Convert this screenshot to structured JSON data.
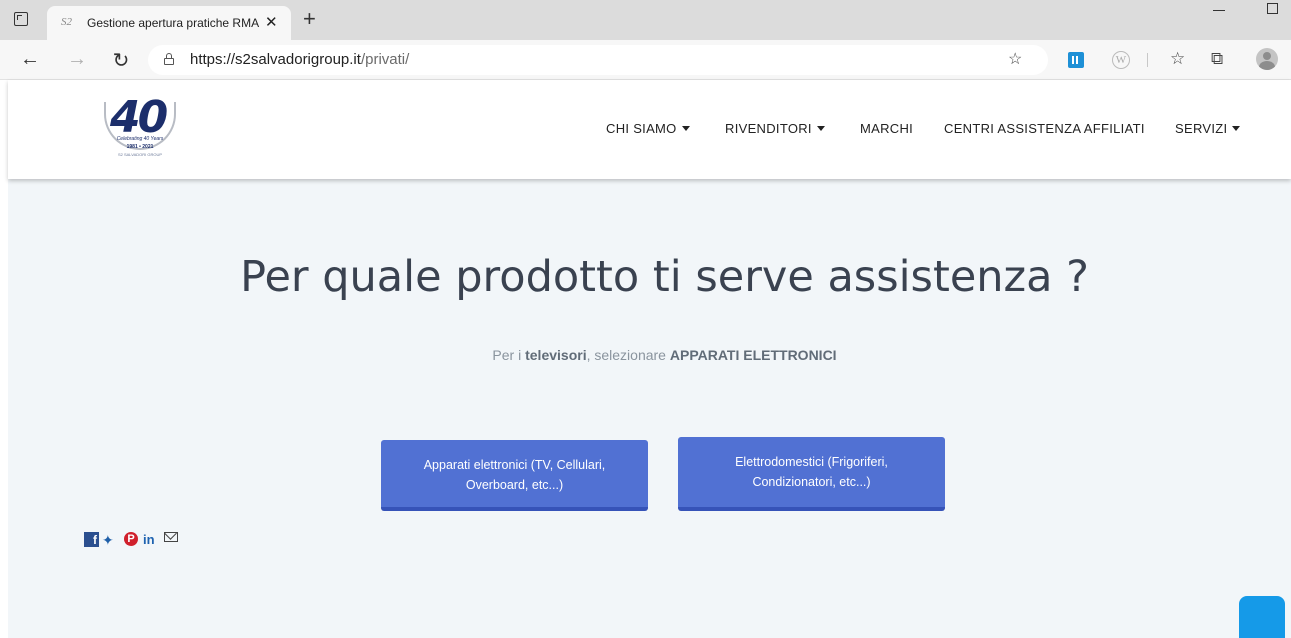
{
  "browser": {
    "tab_title": "Gestione apertura pratiche RMA",
    "tab_favicon": "S2",
    "tab_close": "✕",
    "new_tab": "+",
    "url_host": "https://s2salvadorigroup.it",
    "url_path": "/privati/",
    "icons": {
      "back": "←",
      "forward": "→",
      "refresh": "↻",
      "favorites_add": "☆",
      "extension_w": "W",
      "favorites": "☆",
      "collections": "⧉"
    }
  },
  "header": {
    "logo": {
      "number": "40",
      "band": "Celebrating 40 Years",
      "years": "1981 • 2021",
      "group": "S2 SALVADORI GROUP"
    },
    "menu": [
      {
        "label": "CHI SIAMO",
        "dropdown": true
      },
      {
        "label": "RIVENDITORI",
        "dropdown": true
      },
      {
        "label": "MARCHI",
        "dropdown": false
      },
      {
        "label": "CENTRI ASSISTENZA AFFILIATI",
        "dropdown": false
      },
      {
        "label": "SERVIZI",
        "dropdown": true
      }
    ]
  },
  "main": {
    "headline": "Per quale prodotto ti serve assistenza ?",
    "subtitle": {
      "part1": "Per i ",
      "bold1": "televisori",
      "part2": ", selezionare ",
      "bold2": "APPARATI ELETTRONICI"
    },
    "choices": [
      {
        "line1": "Apparati elettronici (TV, Cellulari,",
        "line2": "Overboard, etc...)"
      },
      {
        "line1": "Elettrodomestici (Frigoriferi,",
        "line2": "Condizionatori, etc...)"
      }
    ]
  },
  "social": {
    "facebook": "f",
    "twitter": "🐦",
    "pinterest": "P",
    "linkedin": "in"
  },
  "colors": {
    "button": "#5171d3",
    "chat": "#159ae8",
    "headline": "#3a4250",
    "page_bg": "#f2f6f9"
  }
}
